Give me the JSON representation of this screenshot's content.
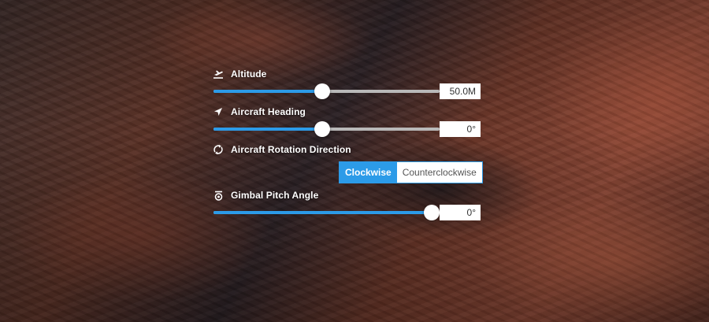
{
  "colors": {
    "accent": "#2c9be8",
    "track": "#b9b9b9"
  },
  "altitude": {
    "label": "Altitude",
    "icon": "airplane-takeoff-icon",
    "value": "50.0M",
    "fraction": 0.48
  },
  "heading": {
    "label": "Aircraft Heading",
    "icon": "navigation-arrow-icon",
    "value": "0°",
    "fraction": 0.48
  },
  "rotation": {
    "label": "Aircraft Rotation Direction",
    "icon": "rotation-icon",
    "options": [
      "Clockwise",
      "Counterclockwise"
    ],
    "selected": "Clockwise"
  },
  "gimbal": {
    "label": "Gimbal Pitch Angle",
    "icon": "gimbal-camera-icon",
    "value": "0°",
    "fraction": 0.965
  }
}
